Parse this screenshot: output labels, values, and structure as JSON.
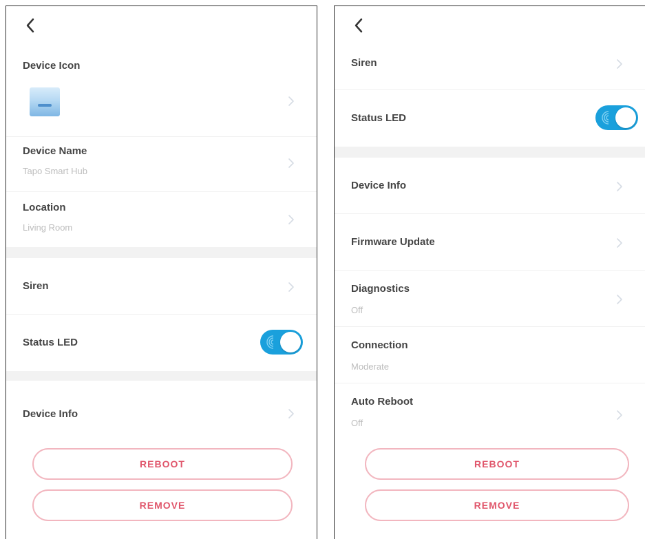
{
  "colors": {
    "toggle_on": "#1aa0dc",
    "danger": "#e0566b",
    "title_text": "#444444",
    "subtitle_text": "#bdbdbd"
  },
  "left_screen": {
    "back_icon": "chevron-left-icon",
    "device_icon": {
      "label": "Device Icon"
    },
    "device_name": {
      "label": "Device Name",
      "value": "Tapo Smart Hub"
    },
    "location": {
      "label": "Location",
      "value": "Living Room"
    },
    "siren": {
      "label": "Siren"
    },
    "status_led": {
      "label": "Status LED",
      "enabled": true
    },
    "device_info": {
      "label": "Device Info"
    },
    "reboot_button": "REBOOT",
    "remove_button": "REMOVE"
  },
  "right_screen": {
    "back_icon": "chevron-left-icon",
    "siren": {
      "label": "Siren"
    },
    "status_led": {
      "label": "Status LED",
      "enabled": true
    },
    "device_info": {
      "label": "Device Info"
    },
    "firmware_update": {
      "label": "Firmware Update"
    },
    "diagnostics": {
      "label": "Diagnostics",
      "value": "Off"
    },
    "connection": {
      "label": "Connection",
      "value": "Moderate"
    },
    "auto_reboot": {
      "label": "Auto Reboot",
      "value": "Off"
    },
    "reboot_button": "REBOOT",
    "remove_button": "REMOVE"
  }
}
